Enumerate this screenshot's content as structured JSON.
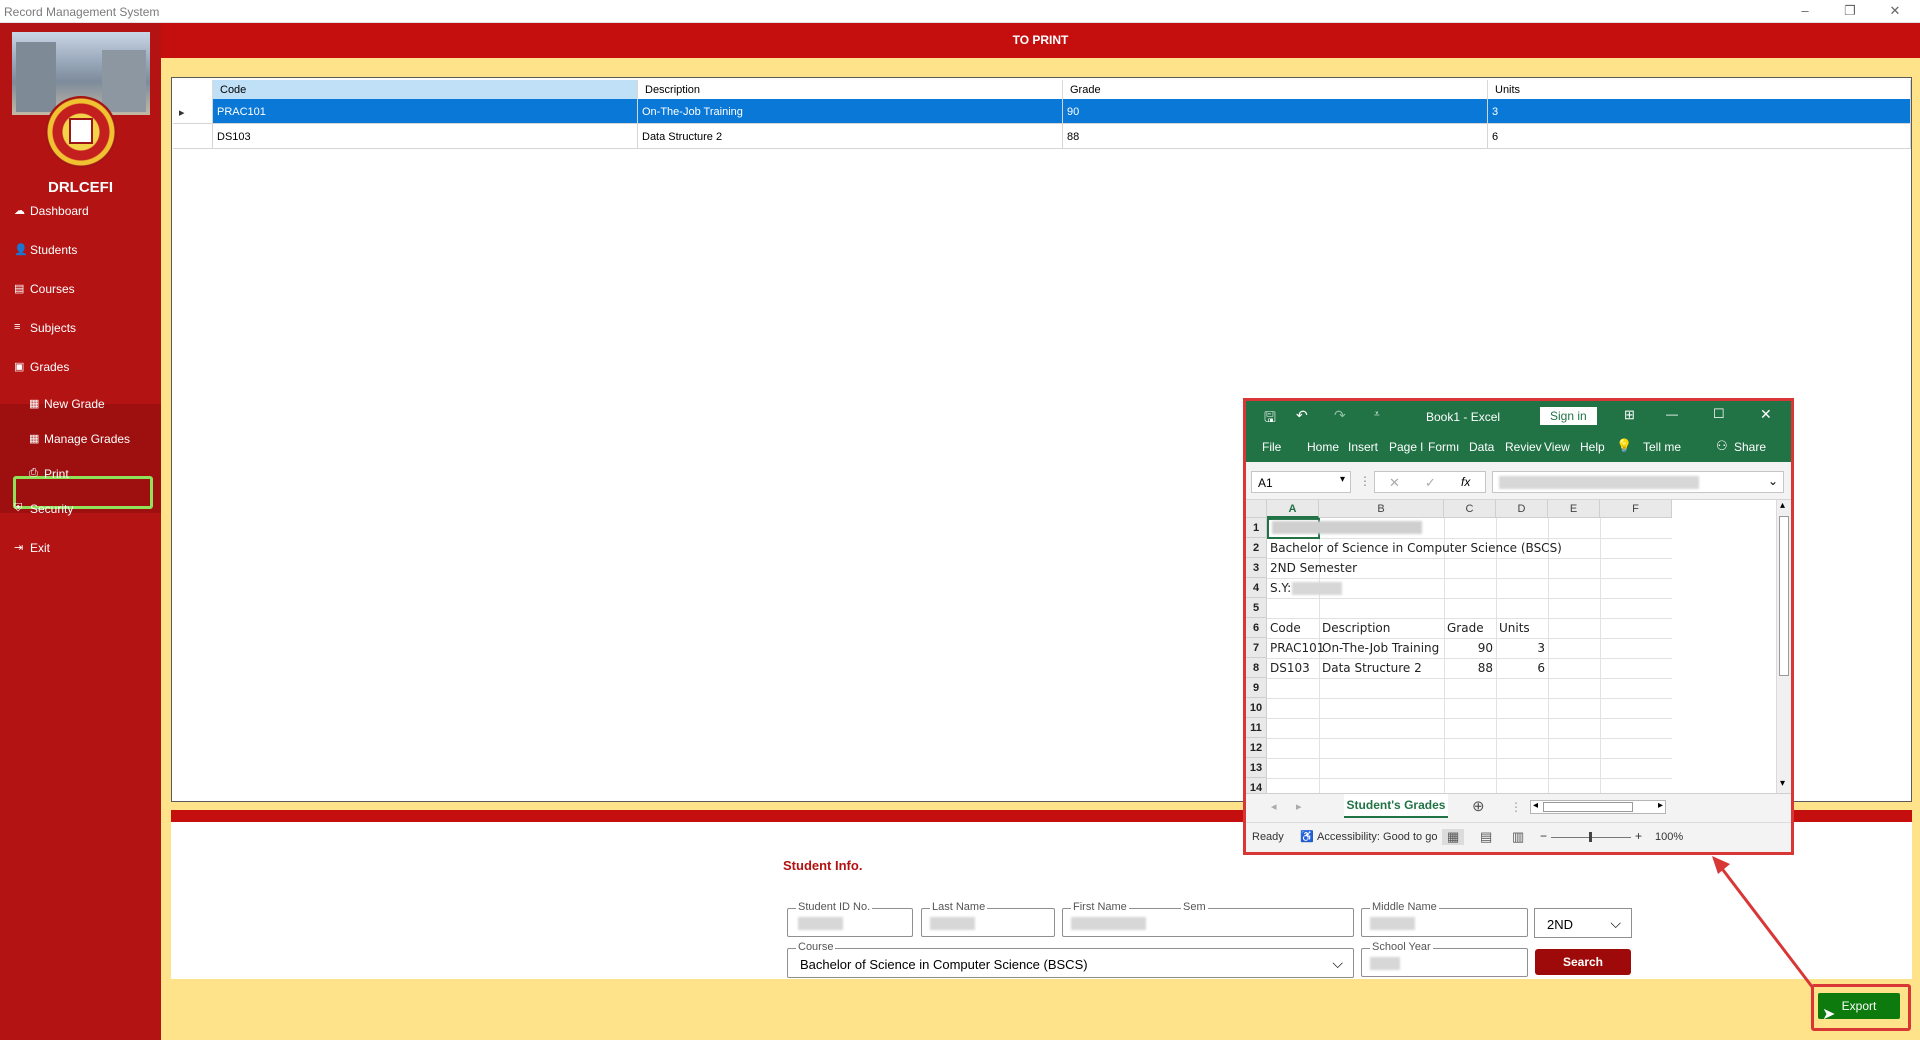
{
  "window": {
    "title": "Record Management System",
    "minimize": "–",
    "restore": "❐",
    "close": "✕"
  },
  "sidebar": {
    "brand": "DRLCEFI",
    "items": [
      {
        "icon": "☁",
        "label": "Dashboard"
      },
      {
        "icon": "👤",
        "label": "Students"
      },
      {
        "icon": "▤",
        "label": "Courses"
      },
      {
        "icon": "≡",
        "label": "Subjects"
      },
      {
        "icon": "▣",
        "label": "Grades"
      },
      {
        "icon": "▦",
        "label": "New  Grade"
      },
      {
        "icon": "▦",
        "label": "Manage Grades"
      },
      {
        "icon": "⎙",
        "label": "Print"
      },
      {
        "icon": "⛨",
        "label": "Security"
      },
      {
        "icon": "⇥",
        "label": "Exit"
      }
    ]
  },
  "header": {
    "title": "TO PRINT"
  },
  "grades_table": {
    "columns": [
      "Code",
      "Description",
      "Grade",
      "Units"
    ],
    "rows": [
      [
        "PRAC101",
        "On-The-Job Training",
        "90",
        "3"
      ],
      [
        "DS103",
        "Data Structure 2",
        "88",
        "6"
      ]
    ],
    "selected_row_marker": "▸"
  },
  "student_info": {
    "heading": "Student Info.",
    "student_id_label": "Student ID No.",
    "last_name_label": "Last Name",
    "first_name_label": "First Name",
    "sem_label": "Sem",
    "middle_name_label": "Middle Name",
    "sem_value": "2ND",
    "course_label": "Course",
    "course_value": "Bachelor of Science in Computer Science (BSCS)",
    "school_year_label": "School Year",
    "search_button": "Search",
    "chevron": "⌵"
  },
  "export_button": "Export",
  "excel": {
    "title": "Book1  -  Excel",
    "sign_in": "Sign in",
    "save_icon": "🖫",
    "undo_icon": "↶",
    "redo_icon": "↷",
    "qat_more": "⩡",
    "ribbon_options": "⊞",
    "minimize": "—",
    "maximize": "☐",
    "close": "✕",
    "tabs": [
      "File",
      "Home",
      "Insert",
      "Page l",
      "Formı",
      "Data",
      "Reviev",
      "View",
      "Help"
    ],
    "tell_me_icon": "💡",
    "tell_me": "Tell me",
    "share_icon": "⚇",
    "share": "Share",
    "name_box": "A1",
    "name_box_dropdown": "▾",
    "fx": "fx",
    "cancel_icon": "✕",
    "enter_icon": "✓",
    "formula_dropdown": "⌄",
    "columns": [
      "A",
      "B",
      "C",
      "D",
      "E",
      "F"
    ],
    "rows": [
      "1",
      "2",
      "3",
      "4",
      "5",
      "6",
      "7",
      "8",
      "9",
      "10",
      "11",
      "12",
      "13",
      "14"
    ],
    "cells": {
      "r2": "Bachelor of Science in Computer Science (BSCS)",
      "r3": "2ND Semester",
      "r4": "S.Y:",
      "r6": [
        "Code",
        "Description",
        "Grade",
        "Units"
      ],
      "r7": [
        "PRAC101",
        "On-The-Job Training",
        "90",
        "3"
      ],
      "r8": [
        "DS103",
        "Data Structure 2",
        "88",
        "6"
      ]
    },
    "sheet_tab": "Student's Grades",
    "add_sheet": "⊕",
    "nav_prev": "◂",
    "nav_next": "▸",
    "hscroll_left": "◂",
    "hscroll_right": "▸",
    "vscroll_up": "▴",
    "vscroll_down": "▾",
    "status": "Ready",
    "accessibility_icon": "♿",
    "accessibility": "Accessibility: Good to go",
    "view_normal": "▦",
    "view_layout": "▤",
    "view_break": "▥",
    "zoom_out": "−",
    "zoom_in": "+",
    "zoom": "100%"
  }
}
